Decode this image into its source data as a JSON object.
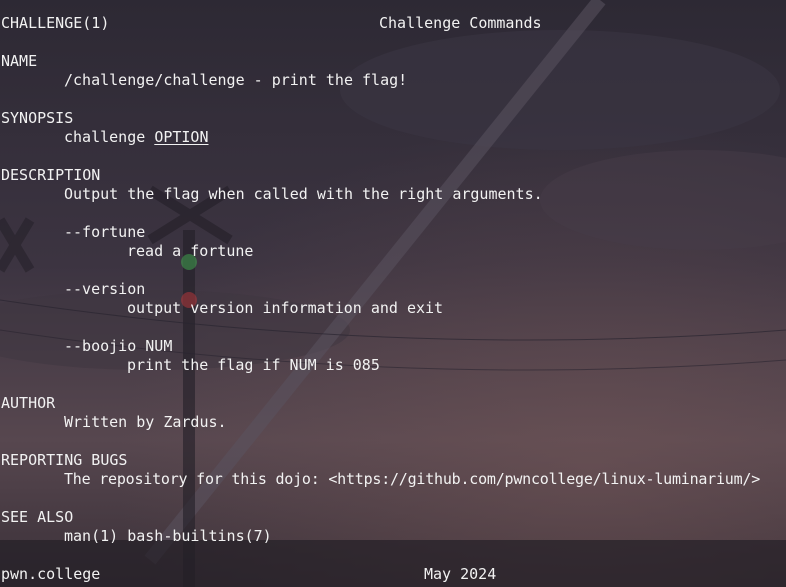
{
  "header": {
    "left": "CHALLENGE(1)",
    "center": "Challenge Commands"
  },
  "name": {
    "heading": "NAME",
    "text": "/challenge/challenge - print the flag!"
  },
  "synopsis": {
    "heading": "SYNOPSIS",
    "command": "challenge ",
    "option": "OPTION"
  },
  "description": {
    "heading": "DESCRIPTION",
    "text": "Output the flag when called with the right arguments.",
    "options": [
      {
        "flag": "--fortune",
        "text": "read a fortune"
      },
      {
        "flag": "--version",
        "text": "output version information and exit"
      },
      {
        "flag": "--boojio NUM",
        "text": "print the flag if NUM is 085"
      }
    ]
  },
  "author": {
    "heading": "AUTHOR",
    "text": "Written by Zardus."
  },
  "bugs": {
    "heading": "REPORTING BUGS",
    "text": "The repository for this dojo: <https://github.com/pwncollege/linux-luminarium/>"
  },
  "see_also": {
    "heading": "SEE ALSO",
    "text": "man(1) bash-builtins(7)"
  },
  "footer": {
    "left": "pwn.college",
    "date": "May 2024"
  },
  "colors": {
    "text": "#f2f2f2",
    "sky_top": "#2e2a37",
    "sky_bottom": "#5b4a55"
  }
}
